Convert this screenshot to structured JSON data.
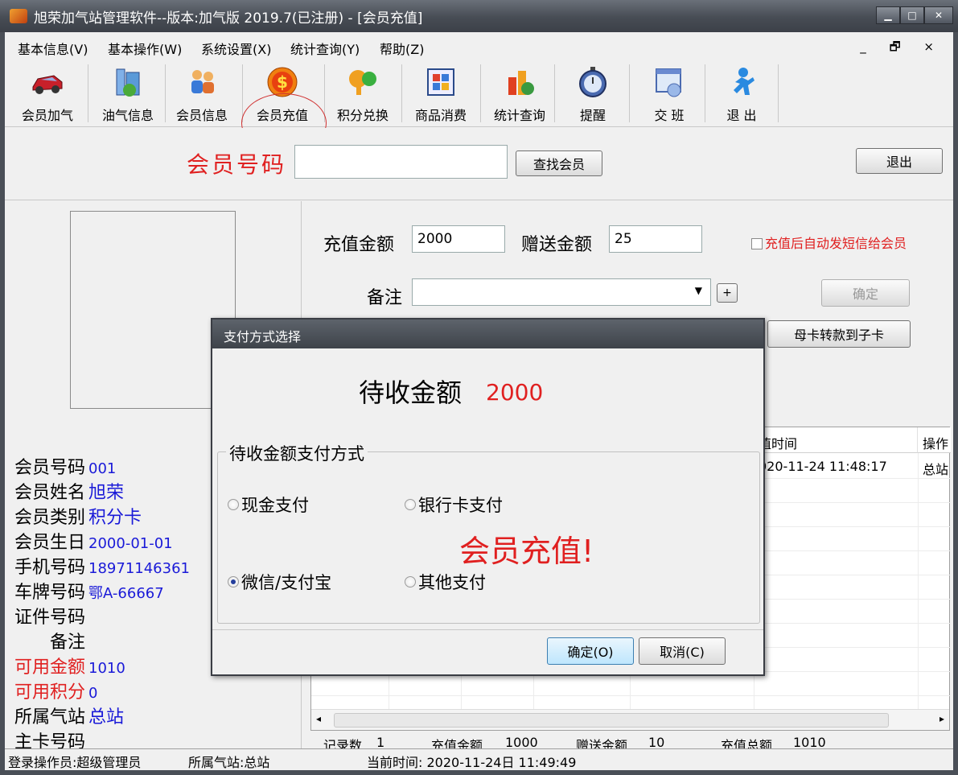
{
  "window": {
    "title": "旭荣加气站管理软件--版本:加气版 2019.7(已注册) - [会员充值]",
    "controls": [
      "minimize-icon",
      "maximize-icon",
      "close-icon"
    ]
  },
  "menu": {
    "items": [
      "基本信息(V)",
      "基本操作(W)",
      "系统设置(X)",
      "统计查询(Y)",
      "帮助(Z)"
    ],
    "mdi_controls": "_ 🗗 ×"
  },
  "toolbar": {
    "items": [
      {
        "label": "会员加气",
        "icon": "car-icon"
      },
      {
        "label": "油气信息",
        "icon": "beaker-icon"
      },
      {
        "label": "会员信息",
        "icon": "people-icon"
      },
      {
        "label": "会员充值",
        "icon": "dollar-coin-icon"
      },
      {
        "label": "积分兑换",
        "icon": "exchange-icon"
      },
      {
        "label": "商品消费",
        "icon": "window-grid-icon"
      },
      {
        "label": "统计查询",
        "icon": "chart-icon"
      },
      {
        "label": "提醒",
        "icon": "stopwatch-icon"
      },
      {
        "label": "交 班",
        "icon": "dialog-window-icon"
      },
      {
        "label": "退 出",
        "icon": "person-exit-icon"
      }
    ]
  },
  "search": {
    "label": "会员号码",
    "value": "",
    "find_button": "查找会员",
    "exit_button": "退出"
  },
  "member": {
    "fields": [
      {
        "label": "会员号码",
        "value": "001",
        "label_color": "black",
        "big": false
      },
      {
        "label": "会员姓名",
        "value": "旭荣",
        "label_color": "black",
        "big": true
      },
      {
        "label": "会员类别",
        "value": "积分卡",
        "label_color": "black",
        "big": true
      },
      {
        "label": "会员生日",
        "value": "2000-01-01",
        "label_color": "black",
        "big": false
      },
      {
        "label": "手机号码",
        "value": "18971146361",
        "label_color": "black",
        "big": false
      },
      {
        "label": "车牌号码",
        "value": "鄂A-66667",
        "label_color": "black",
        "big": false
      },
      {
        "label": "证件号码",
        "value": "",
        "label_color": "black",
        "big": false
      },
      {
        "label": "　　备注",
        "value": "",
        "label_color": "black",
        "big": false
      },
      {
        "label": "可用金额",
        "value": "1010",
        "label_color": "red",
        "big": false
      },
      {
        "label": "可用积分",
        "value": "0",
        "label_color": "red",
        "big": false
      },
      {
        "label": "所属气站",
        "value": "总站",
        "label_color": "black",
        "big": true
      },
      {
        "label": "主卡号码",
        "value": "",
        "label_color": "black",
        "big": false
      }
    ]
  },
  "recharge": {
    "amount_label": "充值金额",
    "amount_value": "2000",
    "bonus_label": "赠送金额",
    "bonus_value": "25",
    "sms_label": "充值后自动发短信给会员",
    "sms_checked": false,
    "remark_label": "备注",
    "remark_value": "",
    "add_button": "+",
    "confirm_button": "确定",
    "transfer_button": "母卡转款到子卡"
  },
  "grid": {
    "columns": [
      "值时间",
      "操作"
    ],
    "rows": [
      [
        "020-11-24 11:48:17",
        "总站"
      ]
    ]
  },
  "summary": {
    "record_label": "记录数",
    "record_value": "1",
    "recharge_label": "充值金额",
    "recharge_value": "1000",
    "bonus_label": "赠送金额",
    "bonus_value": "10",
    "total_label": "充值总额",
    "total_value": "1010"
  },
  "status": {
    "operator": "登录操作员:超级管理员",
    "station": "所属气站:总站",
    "time": "当前时间: 2020-11-24日 11:49:49"
  },
  "dialog": {
    "title": "支付方式选择",
    "amount_label": "待收金额",
    "amount_value": "2000",
    "group_title": "待收金额支付方式",
    "options": [
      {
        "label": "现金支付",
        "selected": false
      },
      {
        "label": "银行卡支付",
        "selected": false
      },
      {
        "label": "微信/支付宝",
        "selected": true
      },
      {
        "label": "其他支付",
        "selected": false
      }
    ],
    "watermark": "会员充值!",
    "ok_button": "确定(O)",
    "cancel_button": "取消(C)"
  },
  "colors": {
    "accent_red": "#e02020",
    "value_blue": "#1a1ad8",
    "title_dark": "#474c54"
  }
}
